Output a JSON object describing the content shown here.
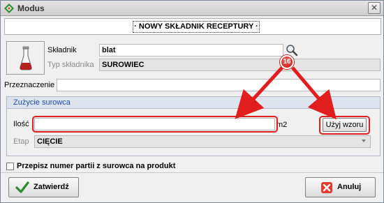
{
  "window": {
    "title": "Modus",
    "close_glyph": "✕"
  },
  "header": {
    "title": "· NOWY SKŁADNIK RECEPTURY ·"
  },
  "form": {
    "skladnik_label": "Składnik",
    "skladnik_value": "blat",
    "typ_label": "Typ składnika",
    "typ_value": "SUROWIEC",
    "przeznaczenie_label": "Przeznaczenie",
    "przeznaczenie_value": ""
  },
  "usage_group": {
    "title": "Zużycie surowca",
    "ilosc_label": "Ilość",
    "ilosc_value": "",
    "unit": "m2",
    "use_formula_label": "Użyj wzoru",
    "etap_label": "Etap",
    "etap_value": "CIĘCIE"
  },
  "copy_batch": {
    "label": "Przepisz numer partii z surowca na produkt",
    "checked": false
  },
  "footer": {
    "confirm_label": "Zatwierdź",
    "cancel_label": "Anuluj"
  },
  "annotation": {
    "badge_number": "16",
    "accent_color": "#e01e1e"
  },
  "icons": {
    "app": "modus-logo-icon",
    "ingredient": "flask-icon",
    "search": "magnifier-icon",
    "confirm": "checkmark-icon",
    "cancel": "red-x-icon"
  }
}
